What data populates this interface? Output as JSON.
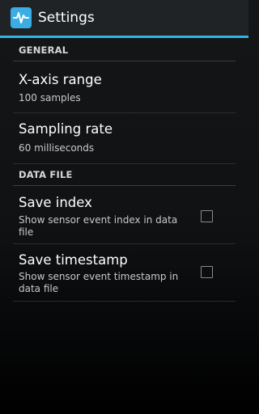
{
  "action_bar": {
    "title": "Settings",
    "icon": "waveform-app-icon",
    "accent_color": "#33b5e5"
  },
  "sections": [
    {
      "header": "GENERAL",
      "items": [
        {
          "title": "X-axis range",
          "summary": "100 samples"
        },
        {
          "title": "Sampling rate",
          "summary": "60 milliseconds"
        }
      ]
    },
    {
      "header": "DATA FILE",
      "items": [
        {
          "title": "Save index",
          "summary": "Show sensor event index in data file",
          "checked": false
        },
        {
          "title": "Save timestamp",
          "summary": "Show sensor event timestamp in data file",
          "checked": false
        }
      ]
    }
  ]
}
